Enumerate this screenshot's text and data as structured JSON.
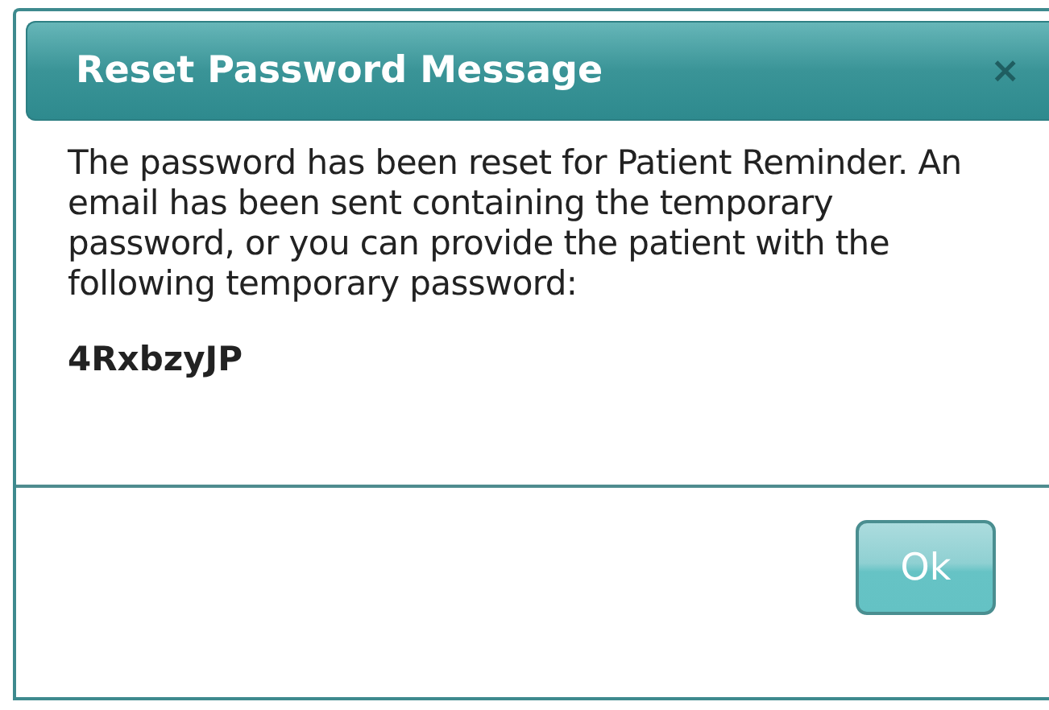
{
  "dialog": {
    "title": "Reset Password Message",
    "close": "×",
    "message": "The password has been reset for Patient Reminder. An email has been sent containing the temporary password, or you can provide the patient with the following temporary password:",
    "password": "4RxbzyJP",
    "buttons": [
      "Ok"
    ]
  }
}
